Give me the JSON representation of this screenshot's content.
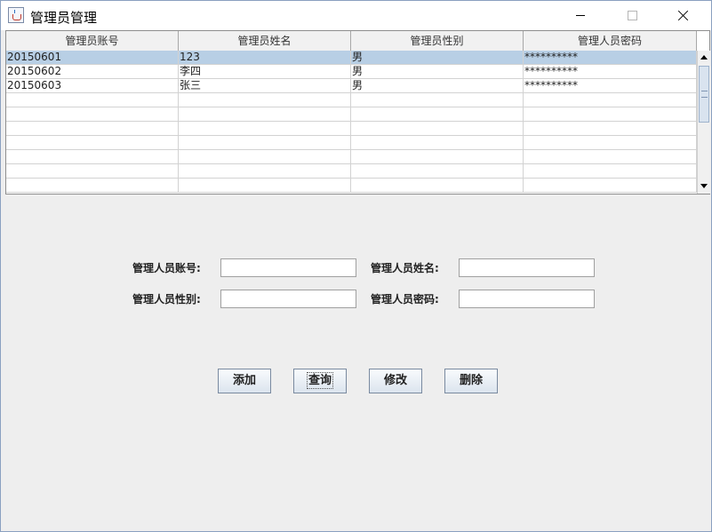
{
  "window": {
    "title": "管理员管理"
  },
  "table": {
    "columns": [
      "管理员账号",
      "管理员姓名",
      "管理员性别",
      "管理人员密码"
    ],
    "rows": [
      [
        "20150601",
        "123",
        "男",
        "**********"
      ],
      [
        "20150602",
        "李四",
        "男",
        "**********"
      ],
      [
        "20150603",
        "张三",
        "男",
        "**********"
      ],
      [
        "",
        "",
        "",
        ""
      ],
      [
        "",
        "",
        "",
        ""
      ],
      [
        "",
        "",
        "",
        ""
      ],
      [
        "",
        "",
        "",
        ""
      ],
      [
        "",
        "",
        "",
        ""
      ],
      [
        "",
        "",
        "",
        ""
      ],
      [
        "",
        "",
        "",
        ""
      ]
    ],
    "selected_row": 0
  },
  "form": {
    "account_label": "管理人员账号:",
    "name_label": "管理人员姓名:",
    "gender_label": "管理人员性别:",
    "password_label": "管理人员密码:",
    "account_value": "",
    "name_value": "",
    "gender_value": "",
    "password_value": ""
  },
  "buttons": {
    "add": "添加",
    "query": "查询",
    "modify": "修改",
    "delete": "删除"
  },
  "colors": {
    "selection": "#b8cfe5",
    "window_bg": "#eeeeee"
  },
  "icons": [
    "java-cup-icon",
    "minimize-icon",
    "maximize-icon",
    "close-icon",
    "scroll-up-icon",
    "scroll-down-icon"
  ]
}
